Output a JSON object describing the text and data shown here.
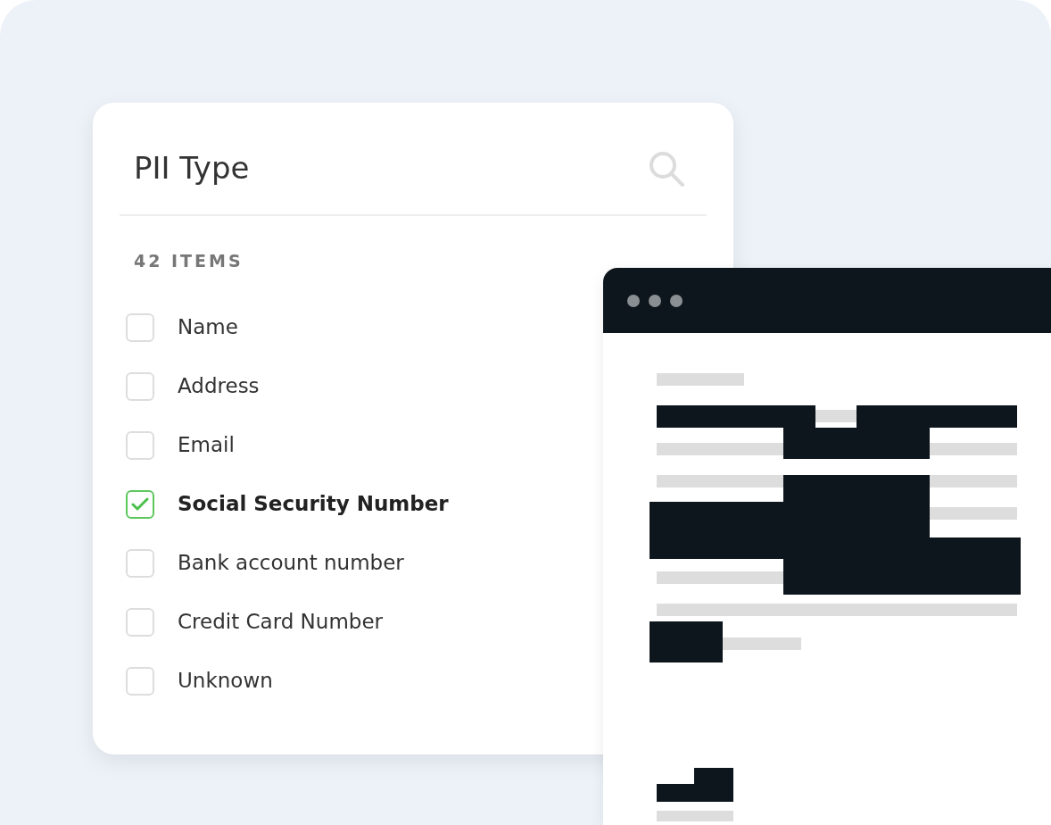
{
  "panel": {
    "title": "PII Type",
    "count": "42 ITEMS",
    "items": [
      {
        "label": "Name",
        "checked": false
      },
      {
        "label": "Address",
        "checked": false
      },
      {
        "label": "Email",
        "checked": false
      },
      {
        "label": "Social Security Number",
        "checked": true
      },
      {
        "label": "Bank account number",
        "checked": false
      },
      {
        "label": "Credit Card Number",
        "checked": false
      },
      {
        "label": "Unknown",
        "checked": false
      }
    ]
  }
}
